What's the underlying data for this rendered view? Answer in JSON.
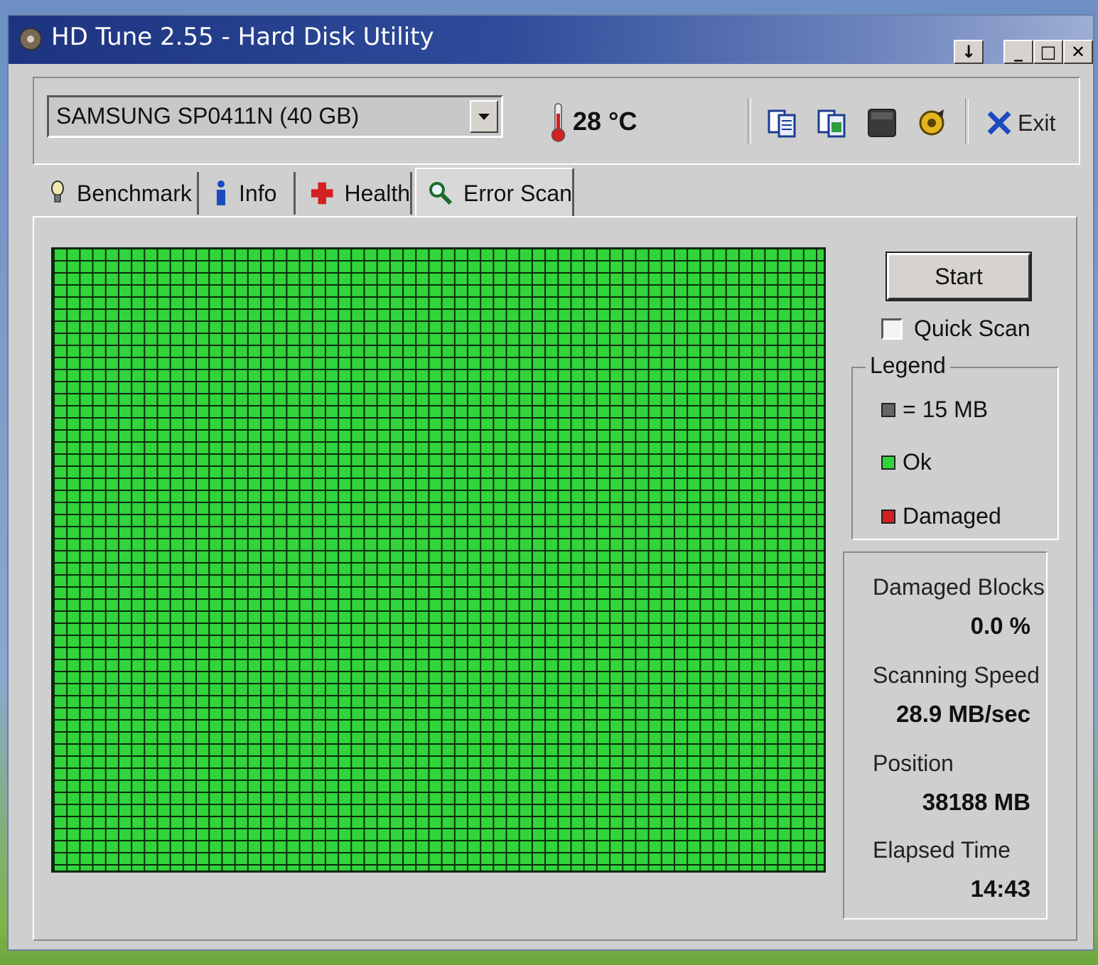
{
  "window": {
    "title": "HD Tune 2.55 - Hard Disk Utility",
    "controls": [
      "download",
      "minimize",
      "maximize",
      "close"
    ]
  },
  "toolbar": {
    "drive": "SAMSUNG SP0411N (40 GB)",
    "temperature": "28 °C",
    "icons": [
      "copy-info-icon",
      "copy-screenshot-icon",
      "options-icon",
      "save-icon"
    ],
    "exit_label": "Exit"
  },
  "tabs": [
    {
      "label": "Benchmark",
      "icon": "benchmark-icon"
    },
    {
      "label": "Info",
      "icon": "info-icon"
    },
    {
      "label": "Health",
      "icon": "health-icon"
    },
    {
      "label": "Error Scan",
      "icon": "magnifier-icon",
      "active": true
    }
  ],
  "scan": {
    "start_label": "Start",
    "quick_scan_label": "Quick Scan",
    "quick_scan_checked": false,
    "legend": {
      "title": "Legend",
      "block_size": "= 15 MB",
      "ok": "Ok",
      "damaged": "Damaged"
    },
    "colors": {
      "ok": "#31d43a",
      "damaged": "#d42020",
      "unscanned": "#666666"
    },
    "stats": {
      "damaged_blocks_label": "Damaged Blocks",
      "damaged_blocks_value": "0.0 %",
      "scanning_speed_label": "Scanning Speed",
      "scanning_speed_value": "28.9 MB/sec",
      "position_label": "Position",
      "position_value": "38188 MB",
      "elapsed_label": "Elapsed Time",
      "elapsed_value": "14:43"
    }
  }
}
